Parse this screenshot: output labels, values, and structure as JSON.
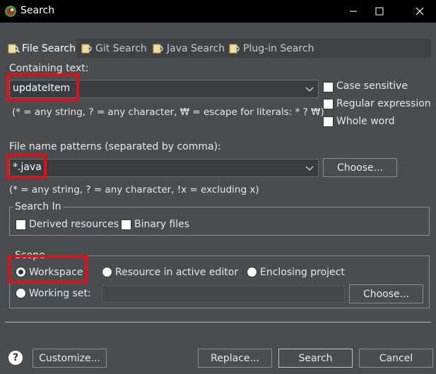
{
  "window": {
    "title": "Search",
    "minimize": "—",
    "maximize": "☐",
    "close": "✕"
  },
  "tabs": [
    {
      "label": "File Search",
      "icon": "file-search-icon",
      "active": true
    },
    {
      "label": "Git Search",
      "icon": "git-search-icon",
      "active": false
    },
    {
      "label": "Java Search",
      "icon": "java-search-icon",
      "active": false
    },
    {
      "label": "Plug-in Search",
      "icon": "plugin-search-icon",
      "active": false
    }
  ],
  "containing": {
    "label": "Containing text:",
    "value": "updateItem",
    "hint": "(* = any string, ? = any character, ₩ = escape for literals: * ? ₩)"
  },
  "options": {
    "case_sensitive": "Case sensitive",
    "regex": "Regular expression",
    "whole_word": "Whole word"
  },
  "file_patterns": {
    "label": "File name patterns (separated by comma):",
    "value": "*.java",
    "hint": "(* = any string, ? = any character, !x = excluding x)",
    "choose": "Choose..."
  },
  "search_in": {
    "legend": "Search In",
    "derived": "Derived resources",
    "binary": "Binary files"
  },
  "scope": {
    "legend": "Scope",
    "workspace": "Workspace",
    "active_editor": "Resource in active editor",
    "enclosing": "Enclosing project",
    "working_set": "Working set:",
    "choose": "Choose..."
  },
  "footer": {
    "help": "?",
    "customize": "Customize...",
    "replace": "Replace...",
    "search": "Search",
    "cancel": "Cancel"
  },
  "colors": {
    "highlight": "#e0101a",
    "background": "#4a4d4f",
    "titlebar": "#000000"
  }
}
